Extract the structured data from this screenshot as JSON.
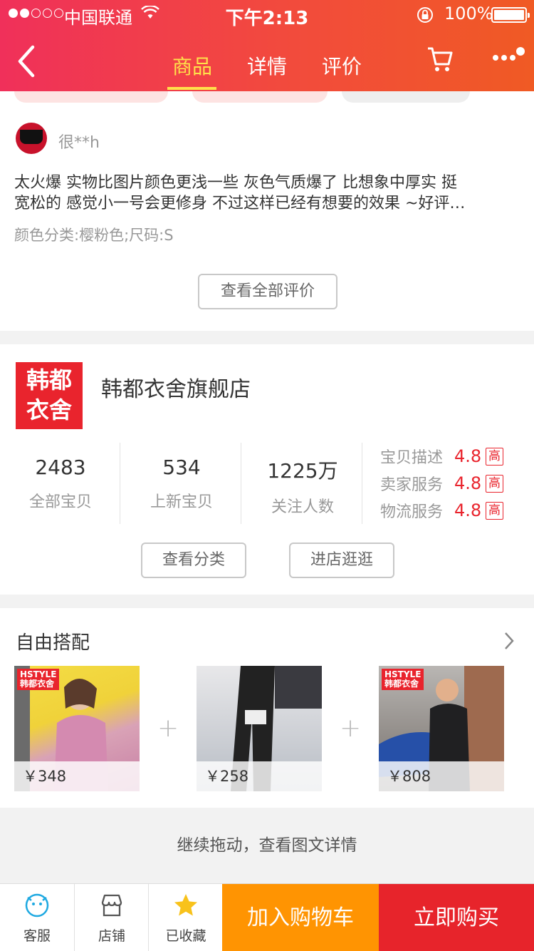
{
  "status": {
    "carrier": "中国联通",
    "time": "下午2:13",
    "battery": "100%"
  },
  "nav": {
    "tabs": [
      {
        "label": "商品",
        "active": true
      },
      {
        "label": "详情",
        "active": false
      },
      {
        "label": "评价",
        "active": false
      }
    ],
    "accent": "#ffe14a"
  },
  "review": {
    "reviewer": "很**h",
    "text_line1": "太火爆 实物比图片颜色更浅一些 灰色气质爆了 比想象中厚实 挺",
    "text_line2": "宽松的 感觉小一号会更修身 不过这样已经有想要的效果 ~好评…",
    "sku": "颜色分类:樱粉色;尺码:S",
    "see_all_label": "查看全部评价"
  },
  "store": {
    "logo_line1": "韩都",
    "logo_line2": "衣舍",
    "name": "韩都衣舍旗舰店",
    "stats": [
      {
        "value": "2483",
        "label": "全部宝贝"
      },
      {
        "value": "534",
        "label": "上新宝贝"
      },
      {
        "value": "1225万",
        "label": "关注人数"
      }
    ],
    "ratings": [
      {
        "label": "宝贝描述",
        "score": "4.8",
        "badge": "高"
      },
      {
        "label": "卖家服务",
        "score": "4.8",
        "badge": "高"
      },
      {
        "label": "物流服务",
        "score": "4.8",
        "badge": "高"
      }
    ],
    "view_category_label": "查看分类",
    "enter_store_label": "进店逛逛"
  },
  "match": {
    "title": "自由搭配",
    "products": [
      {
        "price": "￥348",
        "tag_line1": "HSTYLE",
        "tag_line2": "韩都衣舍"
      },
      {
        "price": "￥258"
      },
      {
        "price": "￥808",
        "tag_line1": "HSTYLE",
        "tag_line2": "韩都衣舍"
      }
    ]
  },
  "continue_text": "继续拖动，查看图文详情",
  "bottom": {
    "service": "客服",
    "shop": "店铺",
    "favorited": "已收藏",
    "add_to_cart": "加入购物车",
    "buy_now": "立即购买"
  },
  "colors": {
    "brand_red": "#e9242d",
    "cart_orange": "#ff9402"
  }
}
